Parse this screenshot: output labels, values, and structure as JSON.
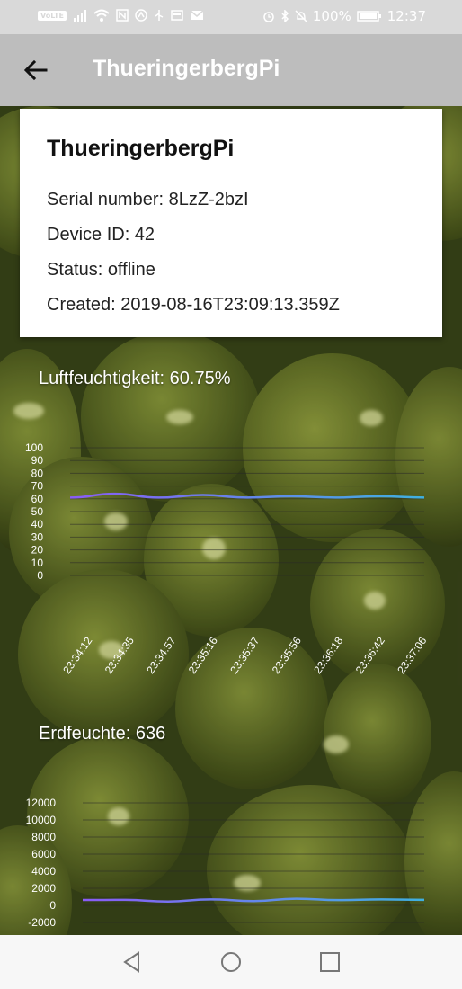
{
  "status_bar": {
    "left_icons": [
      "volte-icon",
      "signal-icon",
      "wifi-icon",
      "nfc-icon",
      "data-saver-icon",
      "usb-icon",
      "screenshot-icon",
      "mail-icon"
    ],
    "volte_label": "VoLTE",
    "battery": "100%",
    "time": "12:37"
  },
  "toolbar": {
    "title": "ThueringerbergPi"
  },
  "device": {
    "name": "ThueringerbergPi",
    "serial": "Serial number: 8LzZ-2bzI",
    "device_id": "Device ID: 42",
    "status": "Status: offline",
    "created": "Created: 2019-08-16T23:09:13.359Z"
  },
  "humidity": {
    "label": "Luftfeuchtigkeit: 60.75%"
  },
  "soil": {
    "label": "Erdfeuchte: 636"
  },
  "colors": {
    "line_start": "#8a5cf6",
    "line_end": "#3fb0e0",
    "toolbar": "#bdbdbd",
    "card": "#ffffff"
  },
  "chart_data": [
    {
      "type": "line",
      "title": "",
      "ylim": [
        0,
        100
      ],
      "yticks": [
        "100",
        "90",
        "80",
        "70",
        "60",
        "50",
        "40",
        "30",
        "20",
        "10",
        "0"
      ],
      "x": [
        "23:34:12",
        "23:34:35",
        "23:34:57",
        "23:35:16",
        "23:35:37",
        "23:35:56",
        "23:36:18",
        "23:36:42",
        "23:37:06"
      ],
      "values": [
        61,
        64,
        61,
        63,
        61,
        62,
        61,
        62,
        61
      ],
      "grid": true
    },
    {
      "type": "line",
      "title": "",
      "ylim": [
        -2000,
        12000
      ],
      "yticks": [
        "12000",
        "10000",
        "8000",
        "6000",
        "4000",
        "2000",
        "0",
        "-2000"
      ],
      "values": [
        636,
        640,
        450,
        700,
        500,
        780,
        620,
        700,
        650
      ],
      "grid": true
    }
  ]
}
